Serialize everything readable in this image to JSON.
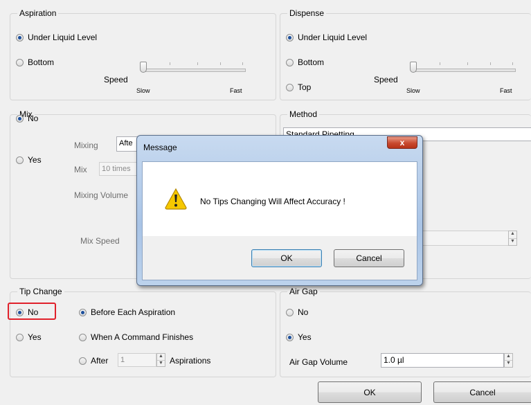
{
  "aspiration": {
    "title": "Aspiration",
    "options": [
      "Under Liquid Level",
      "Bottom"
    ],
    "selected": "Under Liquid Level",
    "speed_label": "Speed",
    "slow_label": "Slow",
    "fast_label": "Fast",
    "speed_level": 0
  },
  "dispense": {
    "title": "Dispense",
    "options": [
      "Under Liquid Level",
      "Bottom",
      "Top"
    ],
    "selected": "Under Liquid Level",
    "speed_label": "Speed",
    "slow_label": "Slow",
    "fast_label": "Fast",
    "speed_level": 0
  },
  "mix": {
    "title": "Mix",
    "options": [
      "No",
      "Yes"
    ],
    "selected": "No",
    "mixing_label": "Mixing",
    "mixing_value": "Afte",
    "mix_label": "Mix",
    "mix_value": "10 times",
    "mixing_volume_label": "Mixing Volume",
    "mix_speed_label": "Mix Speed"
  },
  "method": {
    "title": "Method",
    "value": "Standard Pipetting"
  },
  "tip_change": {
    "title": "Tip Change",
    "options": [
      "No",
      "Yes"
    ],
    "selected": "No",
    "when_options": [
      "Before Each Aspiration",
      "When A Command Finishes",
      "After"
    ],
    "when_selected": "Before Each Aspiration",
    "after_value": "1",
    "aspirations_label": "Aspirations"
  },
  "air_gap": {
    "title": "Air Gap",
    "options": [
      "No",
      "Yes"
    ],
    "selected": "Yes",
    "volume_label": "Air Gap Volume",
    "volume_value": "1.0 µl"
  },
  "footer": {
    "ok_label": "OK",
    "cancel_label": "Cancel"
  },
  "dialog": {
    "title": "Message",
    "close_glyph": "x",
    "message": "No Tips Changing Will Affect Accuracy !",
    "ok_label": "OK",
    "cancel_label": "Cancel"
  },
  "colors": {
    "highlight": "#e0202a",
    "radio_dot": "#1c4f9c"
  },
  "icons": {
    "warning": "warning-triangle-icon",
    "spin": "spin-arrows-icon"
  }
}
